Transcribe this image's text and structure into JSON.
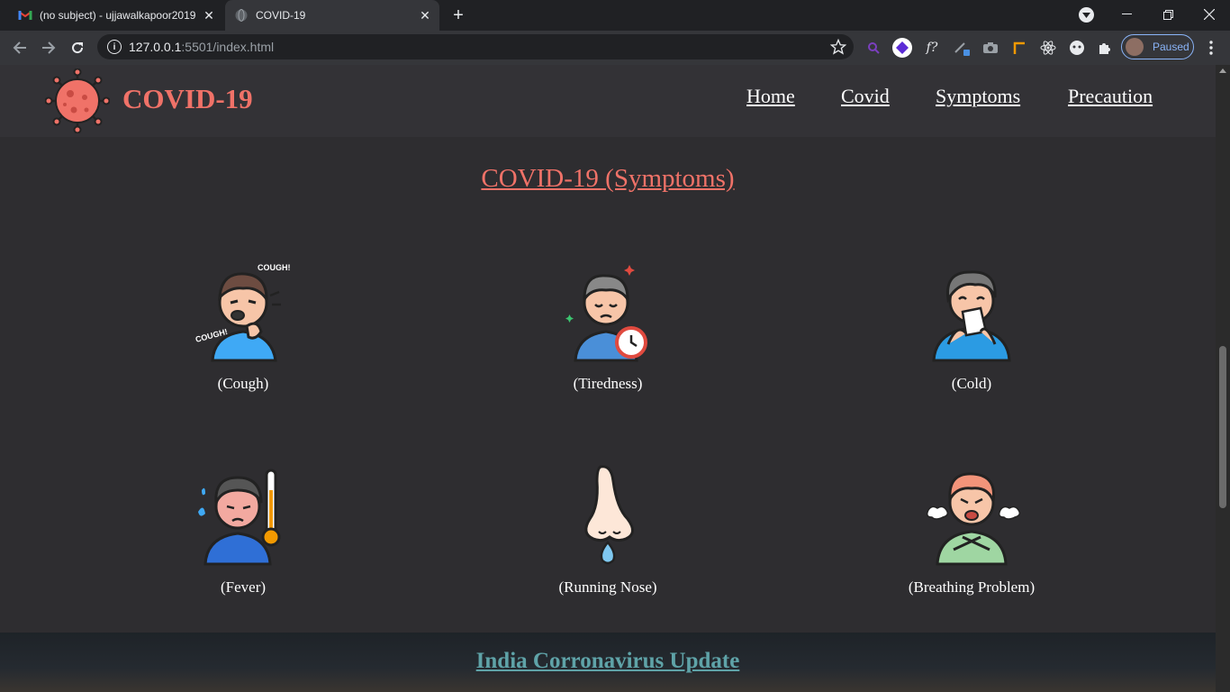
{
  "browser": {
    "tabs": [
      {
        "title": "(no subject) - ujjawalkapoor2019",
        "active": false,
        "favicon": "gmail-icon"
      },
      {
        "title": "COVID-19",
        "active": true,
        "favicon": "globe-icon"
      }
    ],
    "url_host": "127.0.0.1",
    "url_rest": ":5501/index.html",
    "profile_label": "Paused"
  },
  "site": {
    "brand": "COVID-19",
    "nav": [
      "Home",
      "Covid",
      "Symptoms",
      "Precaution"
    ],
    "section_title": "COVID-19 (Symptoms)",
    "symptoms": [
      {
        "label": "(Cough)",
        "icon": "cough-person-icon"
      },
      {
        "label": "(Tiredness)",
        "icon": "tired-person-icon"
      },
      {
        "label": "(Cold)",
        "icon": "sneezing-person-icon"
      },
      {
        "label": "(Fever)",
        "icon": "fever-thermometer-icon"
      },
      {
        "label": "(Running Nose)",
        "icon": "runny-nose-icon"
      },
      {
        "label": "(Breathing Problem)",
        "icon": "breathing-problem-icon"
      }
    ],
    "update_title": "India Corronavirus Update"
  },
  "colors": {
    "accent": "#f07268",
    "page_bg": "#2e2d30",
    "header_bg": "#333236",
    "update_title": "#5fa3a8"
  }
}
